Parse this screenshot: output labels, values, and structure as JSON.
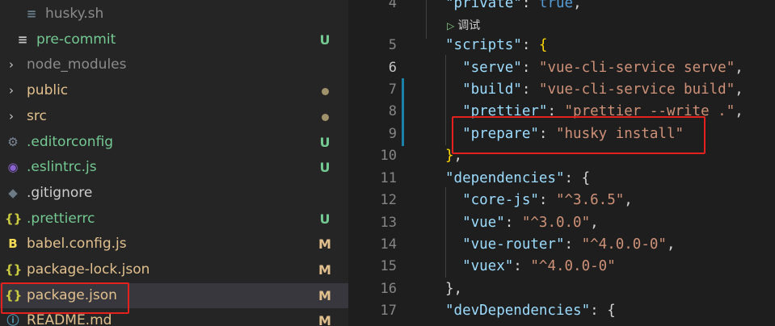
{
  "explorer": {
    "items": [
      {
        "name": "husky.sh",
        "icon": "≡",
        "icon_name": "shell-file-icon",
        "status": "",
        "name_color": "#8b8b8b",
        "icon_color": "#6a7f8c"
      },
      {
        "name": "pre-commit",
        "icon": "≡",
        "icon_name": "file-lines-icon",
        "status": "U",
        "name_color": "#73c991",
        "icon_color": "#c5c5c5"
      },
      {
        "name": "node_modules",
        "chevron": "›",
        "icon_name": "chevron-right-icon",
        "status": "",
        "name_color": "#8b8b8b"
      },
      {
        "name": "public",
        "chevron": "›",
        "icon_name": "chevron-right-icon",
        "status": "dot",
        "name_color": "#e2c08d"
      },
      {
        "name": "src",
        "chevron": "›",
        "icon_name": "chevron-right-icon",
        "status": "dot",
        "name_color": "#e2c08d"
      },
      {
        "name": ".editorconfig",
        "icon": "⚙",
        "icon_name": "gear-icon",
        "status": "U",
        "name_color": "#73c991",
        "icon_color": "#7d8b99"
      },
      {
        "name": ".eslintrc.js",
        "icon": "◉",
        "icon_name": "eslint-icon",
        "status": "U",
        "name_color": "#73c991",
        "icon_color": "#8a63d2"
      },
      {
        "name": ".gitignore",
        "icon": "◆",
        "icon_name": "git-icon",
        "status": "",
        "name_color": "#cccccc",
        "icon_color": "#6d7b86"
      },
      {
        "name": ".prettierrc",
        "icon": "{}",
        "icon_name": "json-braces-icon",
        "status": "U",
        "name_color": "#73c991",
        "icon_color": "#cbcb41"
      },
      {
        "name": "babel.config.js",
        "icon": "B",
        "icon_name": "babel-icon",
        "status": "M",
        "name_color": "#e2c08d",
        "icon_color": "#f5da55"
      },
      {
        "name": "package-lock.json",
        "icon": "{}",
        "icon_name": "json-braces-icon",
        "status": "M",
        "name_color": "#e2c08d",
        "icon_color": "#cbcb41"
      },
      {
        "name": "package.json",
        "icon": "{}",
        "icon_name": "json-braces-icon",
        "status": "M",
        "name_color": "#e2c08d",
        "icon_color": "#cbcb41",
        "active": true
      },
      {
        "name": "README.md",
        "icon": "ⓘ",
        "icon_name": "info-icon",
        "status": "M",
        "name_color": "#e2c08d",
        "icon_color": "#519aba"
      }
    ]
  },
  "status_colors": {
    "U": "#73c991",
    "M": "#e2c08d"
  },
  "editor": {
    "codelens": "调试",
    "lines": [
      {
        "n": "4",
        "tokens": [
          [
            "k",
            "\"private\""
          ],
          [
            "p",
            ": "
          ],
          [
            "blue",
            "true"
          ],
          [
            "p",
            ","
          ]
        ]
      },
      {
        "n": "5",
        "tokens": [
          [
            "k",
            "\"scripts\""
          ],
          [
            "p",
            ": "
          ],
          [
            "b",
            "{"
          ]
        ]
      },
      {
        "n": "6",
        "tokens": [
          [
            "p",
            "  "
          ],
          [
            "k",
            "\"serve\""
          ],
          [
            "p",
            ": "
          ],
          [
            "s",
            "\"vue-cli-service serve\""
          ],
          [
            "p",
            ","
          ]
        ]
      },
      {
        "n": "7",
        "tokens": [
          [
            "p",
            "  "
          ],
          [
            "k",
            "\"build\""
          ],
          [
            "p",
            ": "
          ],
          [
            "s",
            "\"vue-cli-service build\""
          ],
          [
            "p",
            ","
          ]
        ]
      },
      {
        "n": "8",
        "tokens": [
          [
            "p",
            "  "
          ],
          [
            "k",
            "\"prettier\""
          ],
          [
            "p",
            ": "
          ],
          [
            "s",
            "\"prettier --write .\""
          ],
          [
            "p",
            ","
          ]
        ]
      },
      {
        "n": "9",
        "tokens": [
          [
            "p",
            "  "
          ],
          [
            "k",
            "\"prepare\""
          ],
          [
            "p",
            ": "
          ],
          [
            "s",
            "\"husky install\""
          ]
        ]
      },
      {
        "n": "10",
        "tokens": [
          [
            "b",
            "}"
          ],
          [
            "p",
            ","
          ]
        ]
      },
      {
        "n": "11",
        "tokens": [
          [
            "k",
            "\"dependencies\""
          ],
          [
            "p",
            ": "
          ],
          [
            "p",
            "{"
          ]
        ]
      },
      {
        "n": "12",
        "tokens": [
          [
            "p",
            "  "
          ],
          [
            "k",
            "\"core-js\""
          ],
          [
            "p",
            ": "
          ],
          [
            "s",
            "\"^3.6.5\""
          ],
          [
            "p",
            ","
          ]
        ]
      },
      {
        "n": "13",
        "tokens": [
          [
            "p",
            "  "
          ],
          [
            "k",
            "\"vue\""
          ],
          [
            "p",
            ": "
          ],
          [
            "s",
            "\"^3.0.0\""
          ],
          [
            "p",
            ","
          ]
        ]
      },
      {
        "n": "14",
        "tokens": [
          [
            "p",
            "  "
          ],
          [
            "k",
            "\"vue-router\""
          ],
          [
            "p",
            ": "
          ],
          [
            "s",
            "\"^4.0.0-0\""
          ],
          [
            "p",
            ","
          ]
        ]
      },
      {
        "n": "15",
        "tokens": [
          [
            "p",
            "  "
          ],
          [
            "k",
            "\"vuex\""
          ],
          [
            "p",
            ": "
          ],
          [
            "s",
            "\"^4.0.0-0\""
          ]
        ]
      },
      {
        "n": "16",
        "tokens": [
          [
            "p",
            "},"
          ]
        ]
      },
      {
        "n": "17",
        "tokens": [
          [
            "k",
            "\"devDependencies\""
          ],
          [
            "p",
            ": "
          ],
          [
            "p",
            "{"
          ]
        ]
      }
    ]
  }
}
